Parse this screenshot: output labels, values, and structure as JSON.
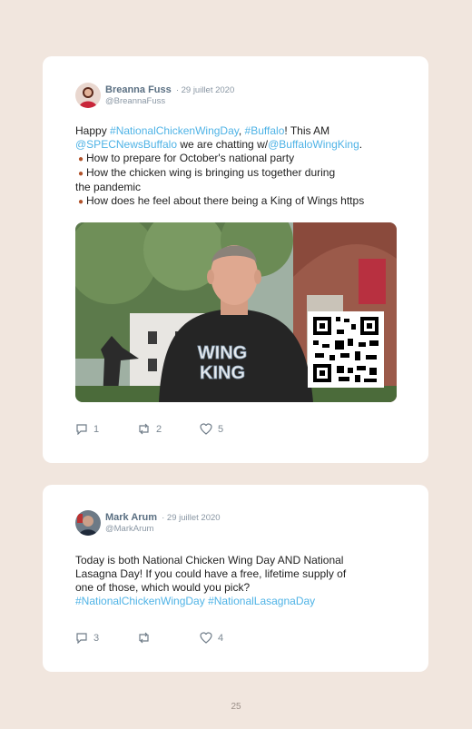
{
  "tweets": [
    {
      "author": "Breanna Fuss",
      "date": "· 29 juillet 2020",
      "handle": "@BreannaFuss",
      "text": {
        "l1a": "Happy ",
        "l1b": "#NationalChickenWingDay",
        "l1c": ", ",
        "l1d": "#Buffalo",
        "l1e": "! This AM",
        "l2a": "@SPECNewsBuffalo",
        "l2b": " we are chatting w/",
        "l2c": "@BuffaloWingKing",
        "l2d": ".",
        "l3": "How to prepare for October's national party",
        "l4": "How the chicken wing is bringing us together during",
        "l5": "the pandemic",
        "l6": "How does he feel about there being a King of Wings https"
      },
      "media": {
        "shirt_line1": "WING",
        "shirt_line2": "KING"
      },
      "replies": "1",
      "retweets": "2",
      "likes": "5"
    },
    {
      "author": "Mark Arum",
      "date": "· 29 juillet 2020",
      "handle": "@MarkArum",
      "text": {
        "l1": "Today is both National Chicken Wing Day AND National",
        "l2": "Lasagna Day! If you could have a free, lifetime supply of",
        "l3": "one of those, which would you pick?",
        "l4a": "#NationalChickenWingDay",
        "l4b": " ",
        "l4c": "#NationalLasagnaDay"
      },
      "replies": "3",
      "retweets": "",
      "likes": "4"
    }
  ],
  "page_number": "25",
  "colors": {
    "link": "#4fb3e6",
    "background": "#f1e6de",
    "meta": "#8a97a4"
  }
}
